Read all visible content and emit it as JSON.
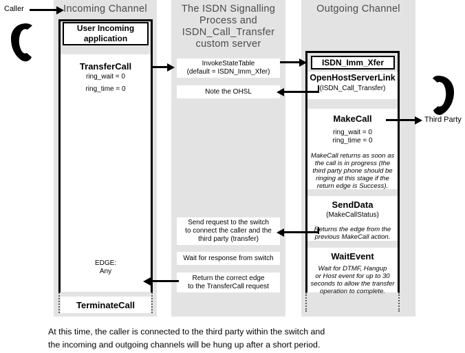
{
  "diagram": {
    "columns": {
      "incoming": {
        "title": "Incoming Channel",
        "app_box": "User Incoming application",
        "transfer_call": {
          "title": "TransferCall",
          "param1": "ring_wait = 0",
          "param2": "ring_time = 0",
          "edge_label": "EDGE:",
          "edge_value": "Any"
        },
        "terminate_call": "TerminateCall"
      },
      "middle": {
        "title_line1": "The ISDN Signalling",
        "title_line2": "Process and",
        "title_line3": "ISDN_Call_Transfer",
        "title_line4": "custom server",
        "invoke_state_table": {
          "line1": "InvokeStateTable",
          "line2": "(default = ISDN_Imm_Xfer)"
        },
        "note_ohsl": "Note the OHSL",
        "send_request": {
          "line1": "Send request to the switch",
          "line2": "to connect the caller and the",
          "line3": "third party (transfer)"
        },
        "wait_response": "Wait for response from switch",
        "return_edge": {
          "line1": "Return the correct edge",
          "line2": "to the TransferCall request"
        }
      },
      "outgoing": {
        "title": "Outgoing Channel",
        "state_table_name": "ISDN_Imm_Xfer",
        "open_host_server_link": {
          "title": "OpenHostServerLink",
          "sub": "(ISDN_Call_Transfer)"
        },
        "make_call": {
          "title": "MakeCall",
          "param1": "ring_wait = 0",
          "param2": "ring_time = 0",
          "note_line1": "MakeCall returns as soon as",
          "note_line2": "the call is in progress (the",
          "note_line3": "third party phone should be",
          "note_line4": "ringing at this stage if the",
          "note_line5": "return edge is Success)."
        },
        "send_data": {
          "title": "SendData",
          "sub": "(MakeCallStatus)",
          "note_line1": "Returns the edge from the",
          "note_line2": "previous MakeCall action."
        },
        "wait_event": {
          "title": "WaitEvent",
          "note_line1": "Wait for DTMF, Hangup",
          "note_line2": "or Host event for up to 30",
          "note_line3": "seconds to allow the transfer",
          "note_line4": "operation to complete."
        }
      }
    },
    "actors": {
      "caller_label": "Caller",
      "caller_icon": "phone-handset-icon",
      "third_party_label": "Third Party",
      "third_party_icon": "phone-handset-icon"
    },
    "caption": {
      "line1": "At this time, the caller is connected to the third party within the switch and",
      "line2": "the incoming and outgoing channels will be hung up after a short period."
    },
    "colors": {
      "column_background": "#e3e3e3",
      "box_background": "#ffffff",
      "title_text": "#4a4a4a",
      "line": "#000000"
    }
  }
}
